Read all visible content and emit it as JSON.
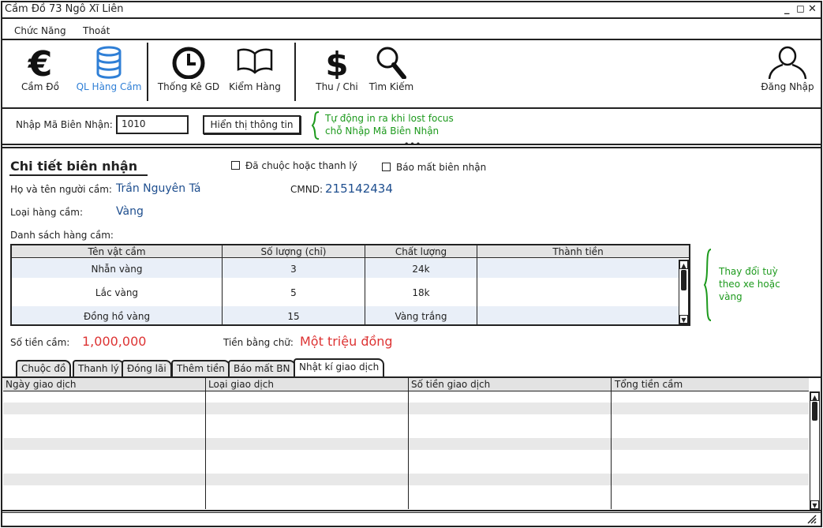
{
  "window": {
    "title": "Cầm Đồ 73 Ngô Xĩ Liên",
    "controls": {
      "minimize": "_",
      "maximize": "◻",
      "close": "✕"
    }
  },
  "menu": {
    "items": [
      "Chức Năng",
      "Thoát"
    ]
  },
  "toolbar": {
    "items": [
      {
        "label": "Cầm Đồ",
        "icon": "euro-icon"
      },
      {
        "label": "QL Hàng Cầm",
        "icon": "database-icon",
        "active": true
      },
      {
        "label": "Thống Kê GD",
        "icon": "clock-icon"
      },
      {
        "label": "Kiểm Hàng",
        "icon": "book-icon"
      },
      {
        "label": "Thu / Chi",
        "icon": "dollar-icon"
      },
      {
        "label": "Tìm Kiếm",
        "icon": "search-icon"
      },
      {
        "label": "Đăng Nhập",
        "icon": "user-icon"
      }
    ]
  },
  "lookup": {
    "label": "Nhập Mã Biên Nhận:",
    "value": "1010",
    "button": "Hiển thị thông tin",
    "note_line1": "Tự động in ra khi lost focus",
    "note_line2": "chỗ Nhập Mã Biên Nhận"
  },
  "detail": {
    "title": "Chi tiết biên nhận",
    "check_redeemed": "Đã chuộc hoặc thanh lý",
    "check_lost": "Báo mất biên nhận",
    "name_label": "Họ và tên người cầm:",
    "name_value": "Trần Nguyên Tá",
    "id_label": "CMND:",
    "id_value": "215142434",
    "type_label": "Loại hàng cầm:",
    "type_value": "Vàng",
    "list_label": "Danh sách hàng cầm:",
    "amount_label": "Số tiền cầm:",
    "amount_value": "1,000,000",
    "words_label": "Tiền bằng chữ:",
    "words_value": "Một triệu đồng"
  },
  "items_table": {
    "columns": [
      "Tên vật cầm",
      "Số lượng (chỉ)",
      "Chất lượng",
      "Thành tiền"
    ],
    "rows": [
      [
        "Nhẫn vàng",
        "3",
        "24k",
        ""
      ],
      [
        "Lắc vàng",
        "5",
        "18k",
        ""
      ],
      [
        "Đồng hồ vàng",
        "15",
        "Vàng trắng",
        ""
      ]
    ],
    "note_line1": "Thay đổi tuỳ",
    "note_line2": "theo xe hoặc",
    "note_line3": "vàng"
  },
  "tabs": [
    "Chuộc đồ",
    "Thanh lý",
    "Đóng lãi",
    "Thêm tiền",
    "Báo mất BN",
    "Nhật kí giao dịch"
  ],
  "log_table": {
    "columns": [
      "Ngày giao dịch",
      "Loại giao dịch",
      "Số tiền giao dịch",
      "Tổng tiền cầm"
    ]
  },
  "colors": {
    "accent": "#2f7fd6",
    "note": "#1d9a1d",
    "money": "#d33333",
    "value": "#1f4f8f"
  }
}
